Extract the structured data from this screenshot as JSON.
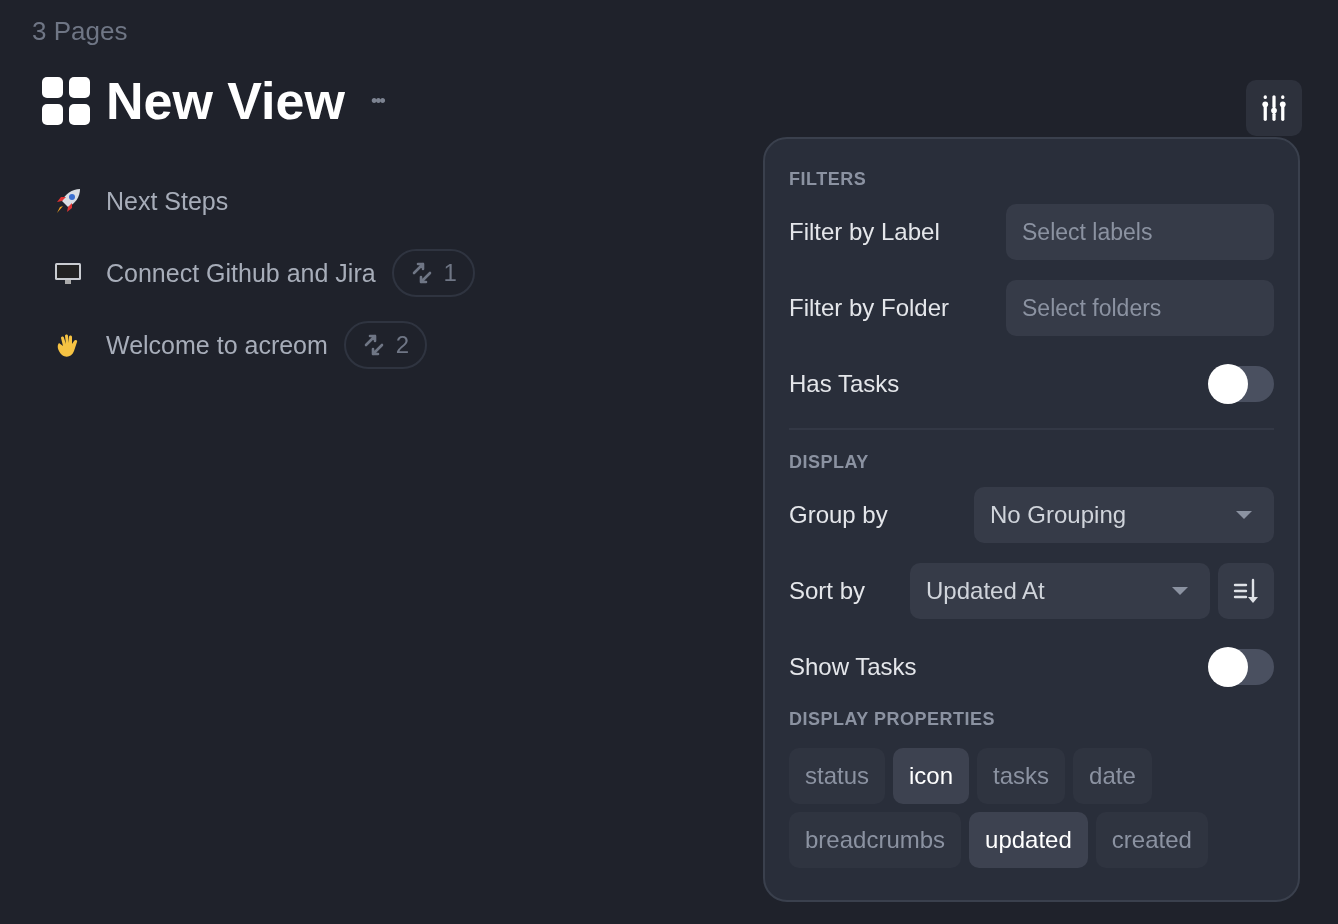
{
  "page_count": "3 Pages",
  "view": {
    "title": "New View",
    "more": "•••"
  },
  "pages": [
    {
      "title": "Next Steps"
    },
    {
      "title": "Connect Github and Jira",
      "links": "1"
    },
    {
      "title": "Welcome to acreom",
      "links": "2"
    }
  ],
  "panel": {
    "filters": {
      "heading": "FILTERS",
      "rows": [
        {
          "kind": "field",
          "label": "Filter by Label",
          "placeholder": "Select labels"
        },
        {
          "kind": "field",
          "label": "Filter by Folder",
          "placeholder": "Select folders"
        },
        {
          "kind": "toggle",
          "label": "Has Tasks",
          "on": false
        }
      ]
    },
    "display": {
      "heading": "DISPLAY",
      "rows": [
        {
          "kind": "select",
          "label": "Group by",
          "value": "No Grouping"
        },
        {
          "kind": "sort",
          "label": "Sort by",
          "value": "Updated At"
        },
        {
          "kind": "toggle",
          "label": "Show Tasks",
          "on": false
        }
      ]
    },
    "properties": {
      "heading": "DISPLAY PROPERTIES",
      "chips": [
        {
          "label": "status",
          "selected": false
        },
        {
          "label": "icon",
          "selected": true
        },
        {
          "label": "tasks",
          "selected": false
        },
        {
          "label": "date",
          "selected": false
        },
        {
          "label": "breadcrumbs",
          "selected": false
        },
        {
          "label": "updated",
          "selected": true
        },
        {
          "label": "created",
          "selected": false
        }
      ]
    }
  }
}
